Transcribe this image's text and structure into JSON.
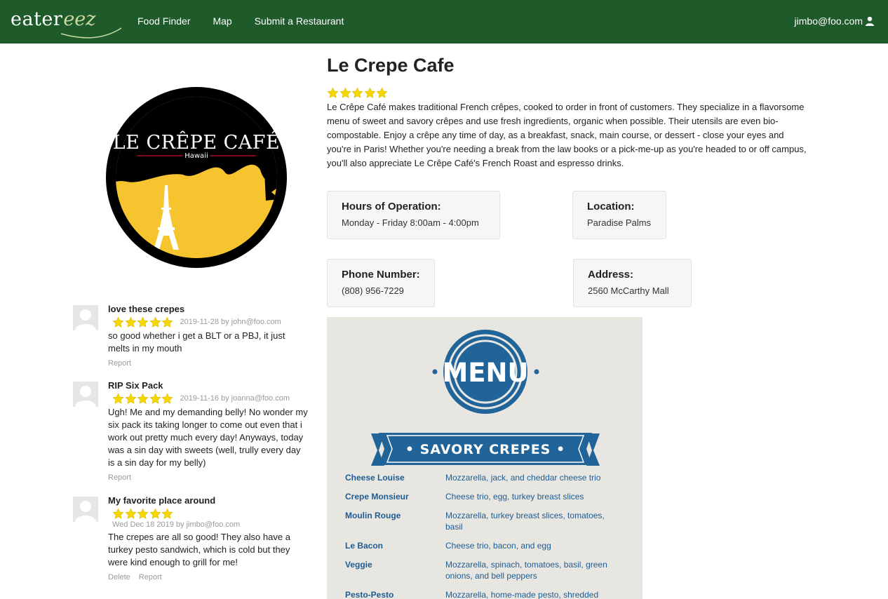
{
  "nav": {
    "brand_main": "eater",
    "brand_script": "eez",
    "links": [
      "Food Finder",
      "Map",
      "Submit a Restaurant"
    ],
    "user": "jimbo@foo.com",
    "user_icon": "user-icon"
  },
  "colors": {
    "navbar": "#1e5a2a",
    "star": "#f5d800",
    "menu_text": "#1e5c93",
    "menu_blue": "#21649a"
  },
  "logo": {
    "name": "LE CRÊPE CAFÉ",
    "subtitle": "Hawaii"
  },
  "restaurant": {
    "name": "Le Crepe Cafe",
    "rating": 5,
    "description": "Le Crêpe Café makes traditional French crêpes, cooked to order in front of customers. They specialize in a flavorsome menu of sweet and savory crêpes and use fresh ingredients, organic when possible. Their utensils are even bio-compostable. Enjoy a crêpe any time of day, as a breakfast, snack, main course, or dessert - close your eyes and you're in Paris! Whether you're needing a break from the law books or a pick-me-up as you're headed to or off campus, you'll also appreciate Le Crêpe Café's French Roast and espresso drinks.",
    "hours_label": "Hours of Operation:",
    "hours": "Monday - Friday 8:00am - 4:00pm",
    "location_label": "Location:",
    "location": "Paradise Palms",
    "phone_label": "Phone Number:",
    "phone": "(808) 956-7229",
    "address_label": "Address:",
    "address": "2560 McCarthy Mall"
  },
  "reviews": [
    {
      "title": "love these crepes",
      "rating": 5,
      "date": "2019-11-28 by john@foo.com",
      "text": "so good whether i get a BLT or a PBJ, it just melts in my mouth",
      "actions": [
        "Report"
      ]
    },
    {
      "title": "RIP Six Pack",
      "rating": 5,
      "date": "2019-11-16 by joanna@foo.com",
      "text": "Ugh! Me and my demanding belly! No wonder my six pack its taking longer to come out even that i work out pretty much every day! Anyways, today was a sin day with sweets (well, trully every day is a sin day for my belly)",
      "actions": [
        "Report"
      ]
    },
    {
      "title": "My favorite place around",
      "rating": 5,
      "date": "Wed Dec 18 2019 by jimbo@foo.com",
      "text": "The crepes are all so good! They also have a turkey pesto sandwich, which is cold but they were kind enough to grill for me!",
      "actions": [
        "Delete",
        "Report"
      ]
    }
  ],
  "menu": {
    "badge": "MENU",
    "section": "• SAVORY CREPES •",
    "items": [
      {
        "name": "Cheese Louise",
        "desc": "Mozzarella, jack, and cheddar cheese trio"
      },
      {
        "name": "Crepe Monsieur",
        "desc": "Cheese trio, egg, turkey breast slices"
      },
      {
        "name": "Moulin Rouge",
        "desc": "Mozzarella, turkey breast slices, tomatoes, basil"
      },
      {
        "name": "Le Bacon",
        "desc": "Cheese trio, bacon, and egg"
      },
      {
        "name": "Veggie",
        "desc": "Mozzarella, spinach, tomatoes, basil, green onions, and bell peppers"
      },
      {
        "name": "Pesto-Pesto",
        "desc": "Mozzarella, home-made pesto, shredded"
      }
    ]
  }
}
